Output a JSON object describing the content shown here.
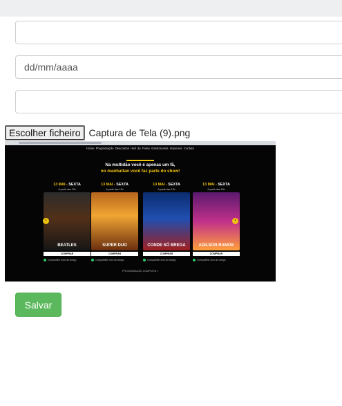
{
  "form": {
    "field1": {
      "value": "",
      "placeholder": ""
    },
    "date_field": {
      "value": "",
      "placeholder": "dd/mm/aaaa"
    },
    "field3": {
      "value": "",
      "placeholder": ""
    },
    "file": {
      "button_label": "Escolher ficheiro",
      "file_name": "Captura de Tela (9).png"
    },
    "save_label": "Salvar"
  },
  "preview": {
    "nav": [
      "Home",
      "Programação",
      "Descontos",
      "Hall da Fama",
      "Gastronomia",
      "Imprensa",
      "Contato"
    ],
    "slogan_line1": "Na multidão você é apenas um fã,",
    "slogan_line2": "no manhattan você faz parte do show!",
    "events": [
      {
        "date": "13 MAI",
        "weekday": "SEXTA",
        "time": "A partir das 19h",
        "title": "BEATLES",
        "buy": "COMPRAR",
        "share": "Compartilhe com um amigo"
      },
      {
        "date": "13 MAI",
        "weekday": "SEXTA",
        "time": "A partir das 19h",
        "title": "SUPER DUO",
        "buy": "COMPRAR",
        "share": "Compartilhe com um amigo"
      },
      {
        "date": "13 MAI",
        "weekday": "SEXTA",
        "time": "A partir das 19h",
        "title": "CONDE SÓ BREGA",
        "buy": "COMPRAR",
        "share": "Compartilhe com um amigo"
      },
      {
        "date": "13 MAI",
        "weekday": "SEXTA",
        "time": "A partir das 19h",
        "title": "ADILSON RAMOS",
        "buy": "COMPRAR",
        "share": "Compartilhe com um amigo"
      }
    ],
    "more_label": "PROGRAMAÇÃO COMPLETA »"
  },
  "colors": {
    "accent_green": "#5cb85c",
    "preview_accent": "#f1c40f"
  },
  "icons": {
    "prev": "chevron-left-icon",
    "next": "chevron-right-icon",
    "share": "share-dot-icon"
  }
}
